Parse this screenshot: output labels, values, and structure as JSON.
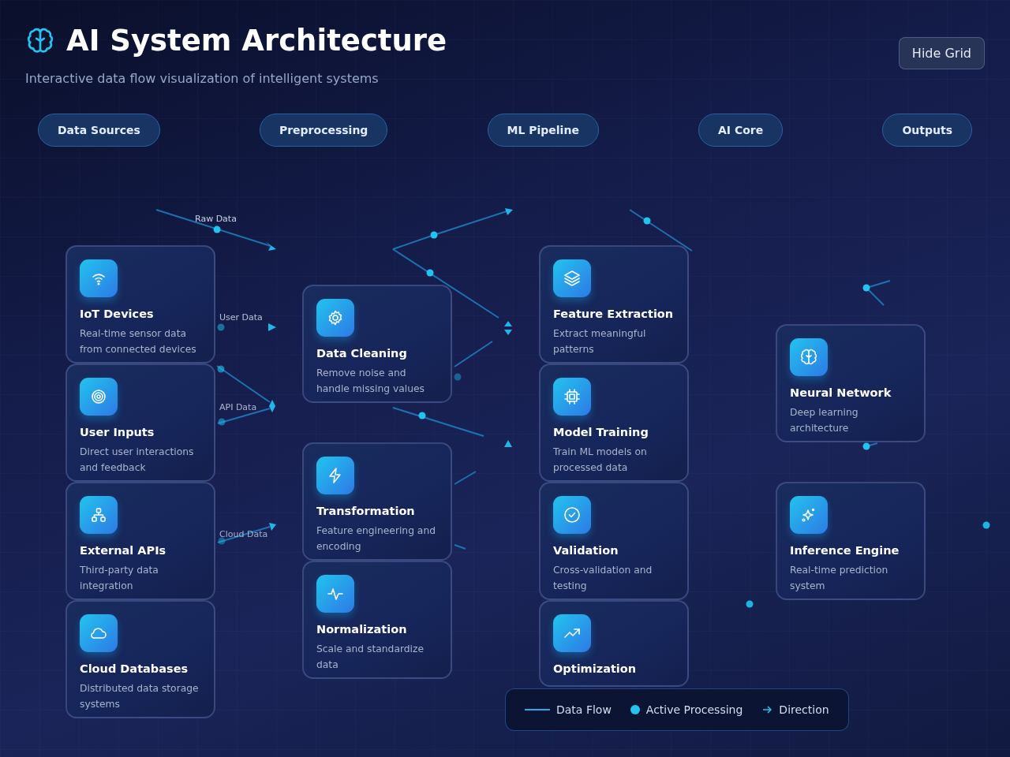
{
  "header": {
    "title": "AI System Architecture",
    "subtitle": "Interactive data flow visualization of intelligent systems"
  },
  "grid_button": {
    "label": "Hide Grid"
  },
  "stages": [
    {
      "label": "Data Sources"
    },
    {
      "label": "Preprocessing"
    },
    {
      "label": "ML Pipeline"
    },
    {
      "label": "AI Core"
    },
    {
      "label": "Outputs"
    }
  ],
  "columns": [
    {
      "nodes": [
        {
          "title": "IoT Devices",
          "description": "Real-time sensor data from connected devices"
        },
        {
          "title": "User Inputs",
          "description": "Direct user interactions and feedback"
        },
        {
          "title": "External APIs",
          "description": "Third-party data integration"
        },
        {
          "title": "Cloud Databases",
          "description": "Distributed data storage systems"
        }
      ]
    },
    {
      "nodes": [
        {
          "title": "Data Cleaning",
          "description": "Remove noise and handle missing values"
        },
        {
          "title": "Transformation",
          "description": "Feature engineering and encoding"
        },
        {
          "title": "Normalization",
          "description": "Scale and standardize data"
        }
      ]
    },
    {
      "nodes": [
        {
          "title": "Feature Extraction",
          "description": "Extract meaningful patterns"
        },
        {
          "title": "Model Training",
          "description": "Train ML models on processed data"
        },
        {
          "title": "Validation",
          "description": "Cross-validation and testing"
        },
        {
          "title": "Optimization"
        }
      ]
    },
    {
      "nodes": [
        {
          "title": "Neural Network",
          "description": "Deep learning architecture"
        },
        {
          "title": "Inference Engine",
          "description": "Real-time prediction system"
        }
      ]
    }
  ],
  "edge_labels": [
    "Raw Data",
    "User Data",
    "API Data",
    "Cloud Data"
  ],
  "legend": [
    {
      "kind": "line",
      "label": "Data Flow"
    },
    {
      "kind": "dot",
      "label": "Active Processing"
    },
    {
      "kind": "arrow",
      "label": "Direction"
    }
  ]
}
